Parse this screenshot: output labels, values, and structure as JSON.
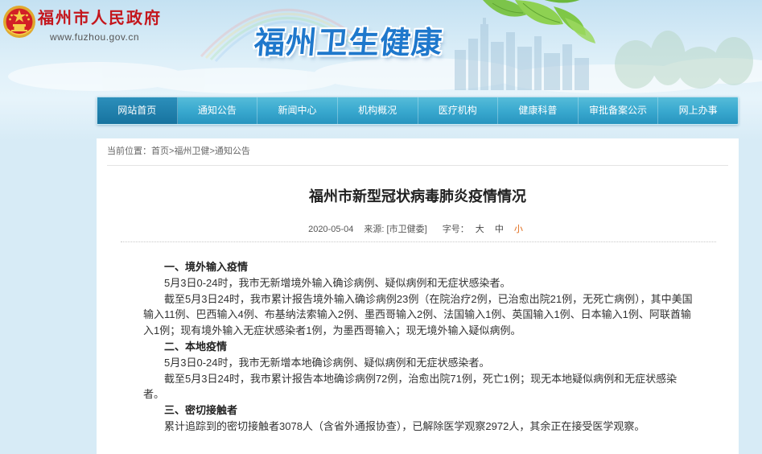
{
  "header": {
    "gov_name": "福州市人民政府",
    "gov_url": "www.fuzhou.gov.cn",
    "site_title": "福州卫生健康",
    "emblem_icon": "national-emblem-icon"
  },
  "nav": {
    "active_index": 0,
    "items": [
      {
        "label": "网站首页"
      },
      {
        "label": "通知公告"
      },
      {
        "label": "新闻中心"
      },
      {
        "label": "机构概况"
      },
      {
        "label": "医疗机构"
      },
      {
        "label": "健康科普"
      },
      {
        "label": "审批备案公示"
      },
      {
        "label": "网上办事"
      }
    ]
  },
  "breadcrumb": {
    "prefix": "当前位置：",
    "separator": ">",
    "items": [
      "首页",
      "福州卫健",
      "通知公告"
    ]
  },
  "article": {
    "title": "福州市新型冠状病毒肺炎疫情情况",
    "date": "2020-05-04",
    "source_label": "来源:",
    "source": "[市卫健委]",
    "font_size_label": "字号：",
    "font_sizes": [
      "大",
      "中",
      "小"
    ],
    "font_size_selected": "小",
    "sections": [
      {
        "heading": "一、境外输入疫情",
        "paragraphs": [
          "5月3日0-24时，我市无新增境外输入确诊病例、疑似病例和无症状感染者。",
          "截至5月3日24时，我市累计报告境外输入确诊病例23例（在院治疗2例，已治愈出院21例，无死亡病例），其中美国输入11例、巴西输入4例、布基纳法索输入2例、墨西哥输入2例、法国输入1例、英国输入1例、日本输入1例、阿联酋输入1例；现有境外输入无症状感染者1例，为墨西哥输入；现无境外输入疑似病例。"
        ]
      },
      {
        "heading": "二、本地疫情",
        "paragraphs": [
          "5月3日0-24时，我市无新增本地确诊病例、疑似病例和无症状感染者。",
          "截至5月3日24时，我市累计报告本地确诊病例72例，治愈出院71例，死亡1例；现无本地疑似病例和无症状感染者。"
        ]
      },
      {
        "heading": "三、密切接触者",
        "paragraphs": [
          "累计追踪到的密切接触者3078人（含省外通报协查），已解除医学观察2972人，其余正在接受医学观察。"
        ]
      }
    ]
  },
  "colors": {
    "gov_red": "#c4161c",
    "site_blue": "#1f78cc",
    "nav_top": "#55bcd9",
    "nav_bottom": "#2794bf",
    "nav_active": "#17739f",
    "font_size_active": "#e06b1a"
  }
}
